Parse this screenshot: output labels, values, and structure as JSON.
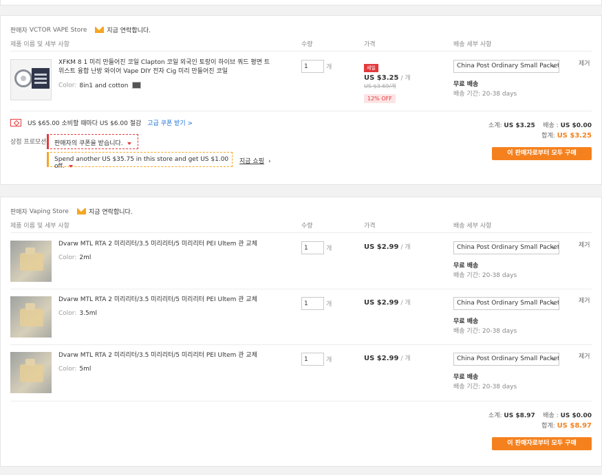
{
  "columns": {
    "product": "제품 이름 및 세부 사항",
    "qty": "수량",
    "price": "가격",
    "shipping": "배송 세부 사항"
  },
  "common": {
    "seller_prefix": "판매자",
    "contact": "지금 연락합니다.",
    "unit": "개",
    "remove": "제거",
    "free_shipping": "무료 배송",
    "color_label": "Color:",
    "subtotal_label": "소계:",
    "shipping_label": "배송 :",
    "total_label": "합계:",
    "buy_all": "이 판매자로부터 모두 구매"
  },
  "store1": {
    "name": "VCTOR VAPE Store",
    "item": {
      "name": "XFKM 8 1 미리 만들어진 코일 Clapton 코일 외국인 토랑이 하이브 쿼드 평면 트위스트 융합 난방 와이어 Vape DIY 전자 Cig 미리 만들어진 코일",
      "color": "8in1 and cotton",
      "qty": "1",
      "sale_badge": "세일",
      "price": "US $3.25",
      "per": "/ 개",
      "old_price": "US $3.69/개",
      "discount": "12% OFF",
      "shipping": "China Post Ordinary Small Packet",
      "delivery": "배송 기간: 20-38 days"
    },
    "coupon": {
      "text": "US $65.00 소비할 때마다 US $6.00 절감",
      "link": "고급 쿠폰 받기 >"
    },
    "promo_label": "상점 프로모션:",
    "promo1": "판매자의 쿠폰을 받습니다.",
    "promo2": "Spend another US $35.75 in this store and get US $1.00 off.",
    "shop_now": "지금 쇼핑",
    "subtotal": "US $3.25",
    "shipping_cost": "US $0.00",
    "total": "US $3.25"
  },
  "store2": {
    "name": "Vaping Store",
    "items": [
      {
        "name": "Dvarw MTL RTA 2 미리리터/3.5 미리리터/5 미리리터 PEI Ultem 관 교체",
        "color": "2ml",
        "qty": "1",
        "price": "US $2.99",
        "per": "/ 개",
        "shipping": "China Post Ordinary Small Packet",
        "delivery": "배송 기간: 20-38 days"
      },
      {
        "name": "Dvarw MTL RTA 2 미리리터/3.5 미리리터/5 미리리터 PEI Ultem 관 교체",
        "color": "3.5ml",
        "qty": "1",
        "price": "US $2.99",
        "per": "/ 개",
        "shipping": "China Post Ordinary Small Packet",
        "delivery": "배송 기간: 20-38 days"
      },
      {
        "name": "Dvarw MTL RTA 2 미리리터/3.5 미리리터/5 미리리터 PEI Ultem 관 교체",
        "color": "5ml",
        "qty": "1",
        "price": "US $2.99",
        "per": "/ 개",
        "shipping": "China Post Ordinary Small Packet",
        "delivery": "배송 기간: 20-38 days"
      }
    ],
    "subtotal": "US $8.97",
    "shipping_cost": "US $0.00",
    "total": "US $8.97"
  },
  "colors": {
    "accent": "#f5811e",
    "sale": "#e4393c",
    "link": "#1a6fd6"
  }
}
